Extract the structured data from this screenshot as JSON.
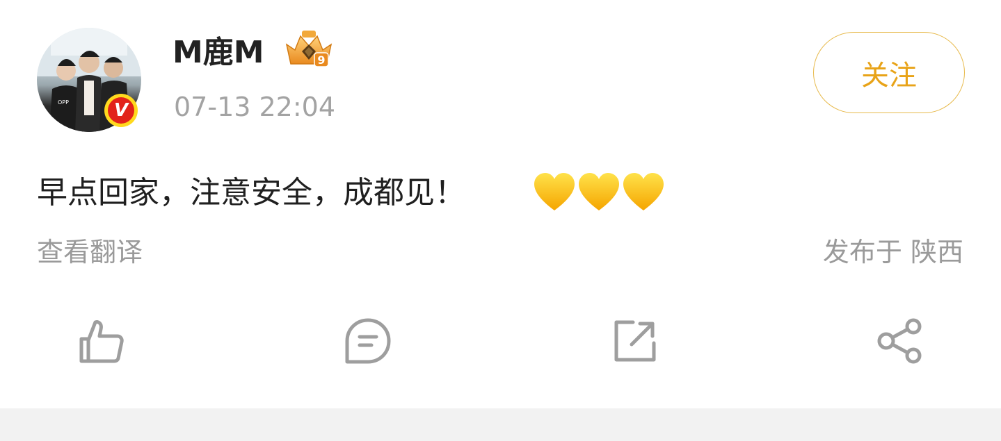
{
  "post": {
    "username": "M鹿M",
    "timestamp": "07-13 22:04",
    "follow_label": "关注",
    "text": "早点回家，注意安全，成都见！",
    "emoji": [
      "yellow-heart",
      "yellow-heart",
      "yellow-heart"
    ],
    "translate_label": "查看翻译",
    "location_label": "发布于 陕西",
    "verified_badge": "V",
    "level_badge": "9"
  },
  "actions": [
    {
      "name": "like",
      "icon": "thumbs-up-icon"
    },
    {
      "name": "comment",
      "icon": "comment-icon"
    },
    {
      "name": "repost",
      "icon": "repost-icon"
    },
    {
      "name": "share",
      "icon": "share-icon"
    }
  ],
  "colors": {
    "follow_accent": "#e8a318",
    "muted_text": "#a3a3a3",
    "icon_gray": "#9e9e9e",
    "background": "#ffffff",
    "footer_band": "#f2f2f2"
  }
}
